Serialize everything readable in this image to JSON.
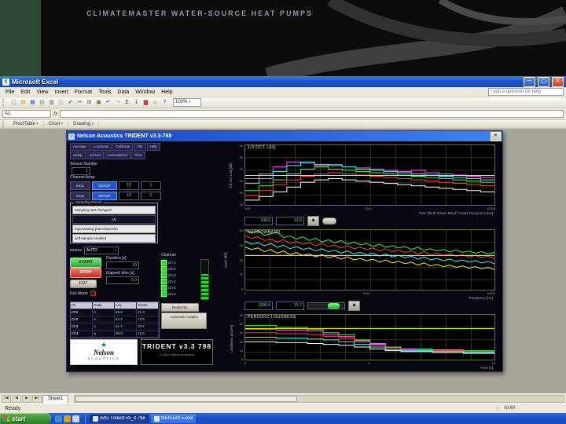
{
  "slide": {
    "title": "CLIMATEMASTER WATER-SOURCE HEAT PUMPS"
  },
  "excel": {
    "window_title": "Microsoft Excel",
    "menus": [
      "File",
      "Edit",
      "View",
      "Insert",
      "Format",
      "Tools",
      "Data",
      "Window",
      "Help"
    ],
    "help_placeholder": "Type a question for help",
    "name_box": "A1",
    "zoom_value": "100%",
    "toolbar_icons": [
      {
        "name": "new-icon",
        "glyph": "▢",
        "fg": "#4a6da8"
      },
      {
        "name": "open-icon",
        "glyph": "▤",
        "fg": "#c89020"
      },
      {
        "name": "save-icon",
        "glyph": "▦",
        "fg": "#3b5bbf"
      },
      {
        "name": "email-icon",
        "glyph": "▧",
        "fg": "#7a8ab0"
      },
      {
        "name": "print-icon",
        "glyph": "▥",
        "fg": "#666666"
      },
      {
        "name": "print-preview-icon",
        "glyph": "◫",
        "fg": "#888888"
      },
      {
        "name": "spelling-icon",
        "glyph": "✔",
        "fg": "#2f7d2f"
      },
      {
        "name": "cut-icon",
        "glyph": "✂",
        "fg": "#555555"
      },
      {
        "name": "copy-icon",
        "glyph": "⊞",
        "fg": "#556699"
      },
      {
        "name": "paste-icon",
        "glyph": "▣",
        "fg": "#8a6a3a"
      },
      {
        "name": "undo-icon",
        "glyph": "↶",
        "fg": "#2a5ad0"
      },
      {
        "name": "redo-icon",
        "glyph": "↷",
        "fg": "#98a2b8"
      },
      {
        "name": "autosum-icon",
        "glyph": "Σ",
        "fg": "#333333"
      },
      {
        "name": "sort-asc-icon",
        "glyph": "↧",
        "fg": "#446688"
      },
      {
        "name": "chart-wizard-icon",
        "glyph": "▆",
        "fg": "#c04040"
      },
      {
        "name": "drawing-icon",
        "glyph": "◇",
        "fg": "#4a8a4a"
      },
      {
        "name": "help-icon",
        "glyph": "?",
        "fg": "#2a5ad0"
      }
    ],
    "toolbar2_items": [
      "PivotTable",
      "Chart",
      "Drawing"
    ],
    "sheet_tab": "Sheet1",
    "status_left": "Ready",
    "status_num": "NUM"
  },
  "trident": {
    "title": "Nelson Acoustics TRIDENT v3.3-798",
    "tabs_row1": [
      "Average",
      "Loudness",
      "Calibrate",
      "File",
      "Help"
    ],
    "tabs_row2": [
      "Setup",
      "1/3 Oct",
      "Narrowband",
      "Time"
    ],
    "sensor_number_label": "Sensor Number",
    "sensor_number": "1",
    "channel_array_label": "Channel Array",
    "key_rows": [
      {
        "key": "Key1",
        "toggle": "On-ICP",
        "gain": "10",
        "ch": "1"
      },
      {
        "key": "Key2",
        "toggle": "On-ICP",
        "gain": "10",
        "ch": "2"
      }
    ],
    "sampling": {
      "group_label": "Sampling Period",
      "rows": [
        "sampling rate changed!",
        "AC",
        "input analog (low channels)",
        "self-sample enabled"
      ]
    },
    "source_label": "source",
    "source_value": "AUTO",
    "start": "START",
    "stop": "STOP",
    "exit": "EXIT",
    "key_alarm": "Key Alarm",
    "duration_label": "Duration [s]",
    "duration_value": "10",
    "elapsed_label": "Elapsed time [s]",
    "elapsed_value": "0.0",
    "channel_label": "Channel",
    "channels": [
      "Ch 1",
      "Ch 2",
      "Ch 3",
      "Ch 4",
      "Ch 5",
      "Ch 6"
    ],
    "reset_dl": "Reset D/L",
    "auto_graphs": "Automatic Graphs",
    "table": {
      "headers": [
        "Ch",
        "Code",
        "Leq",
        "Sones"
      ],
      "rows": [
        [
          "Ch1",
          "A",
          "68.4",
          "21.3"
        ],
        [
          "Ch2",
          "A",
          "64.2",
          "17.8"
        ],
        [
          "Ch3",
          "A",
          "61.7",
          "15.2"
        ],
        [
          "Ch4",
          "A",
          "58.9",
          "12.6"
        ]
      ]
    },
    "logo": {
      "brand": "Nelson",
      "brand2": "ACOUSTICS",
      "product": "TRIDENT v3.3 798",
      "copyright": "© 2004 Nelson Acoustics"
    },
    "controls1": {
      "v1": "100.0",
      "v2": "63.0"
    },
    "controls2": {
      "v1": "1000.0",
      "v2": "15.7"
    }
  },
  "taskbar": {
    "start_label": "start",
    "quick_launch": [
      {
        "name": "browser-icon",
        "color": "#3f8fd0"
      },
      {
        "name": "mail-icon",
        "color": "#d8a020"
      },
      {
        "name": "show-desktop-icon",
        "color": "#cfd8e8"
      }
    ],
    "tasks": [
      {
        "label": "IMG Trident v3_3 798",
        "active": true
      },
      {
        "label": "Microsoft Excel",
        "active": false
      }
    ]
  },
  "chart_data": [
    {
      "type": "step",
      "title": "1/3 OCT LEQ",
      "ylabel": "1/3 Oct Leq [dB]",
      "xlabel": "One-Third Octave Band Center Frequency [Hz]",
      "xticks": [
        "100",
        "1000",
        "10000"
      ],
      "yticks": [
        90,
        80,
        70,
        60,
        50,
        40
      ],
      "ylim": [
        40,
        90
      ],
      "cursor_frac": 0.5,
      "series": [
        {
          "name": "Ch 1",
          "color": "#ff55ff",
          "values": [
            62,
            66,
            72,
            76,
            75,
            73,
            74,
            72,
            71,
            70,
            69,
            68,
            69,
            67,
            66,
            65,
            64,
            63
          ]
        },
        {
          "name": "Ch 2",
          "color": "#44eeee",
          "values": [
            58,
            62,
            68,
            73,
            76,
            74,
            73,
            72,
            70,
            69,
            68,
            67,
            66,
            65,
            64,
            63,
            62,
            61
          ]
        },
        {
          "name": "Ch 3",
          "color": "#44ee44",
          "values": [
            52,
            56,
            61,
            66,
            70,
            72,
            70,
            69,
            68,
            67,
            66,
            65,
            64,
            63,
            62,
            61,
            60,
            59
          ]
        },
        {
          "name": "Ch 4",
          "color": "#ee4444",
          "values": [
            48,
            52,
            57,
            61,
            64,
            66,
            67,
            66,
            65,
            64,
            63,
            62,
            61,
            60,
            59,
            58,
            57,
            56
          ]
        },
        {
          "name": "Ch 5",
          "color": "#ffffff",
          "values": [
            44,
            47,
            51,
            55,
            59,
            61,
            62,
            61,
            60,
            59,
            58,
            57,
            56,
            55,
            54,
            53,
            52,
            51
          ]
        }
      ]
    },
    {
      "type": "line",
      "title": "NARROWBAND",
      "ylabel": "Level [dB]",
      "xlabel": "Frequency [Hz]",
      "xticks": [
        "0",
        "5000",
        "10000"
      ],
      "yticks": [
        80,
        60,
        40,
        20,
        0
      ],
      "ylim": [
        0,
        80
      ],
      "cursor_frac": 0.42,
      "series": [
        {
          "name": "Ch 1",
          "color": "#44ee44",
          "values": [
            80,
            76,
            79,
            73,
            75,
            77,
            70,
            72,
            68,
            71,
            66,
            69,
            64,
            67,
            63,
            66,
            61,
            64,
            60,
            62,
            58,
            61,
            57,
            59,
            56,
            58,
            54,
            57,
            53,
            55,
            52,
            54,
            51,
            53,
            50,
            52,
            49,
            51,
            48,
            50
          ]
        },
        {
          "name": "Ch 2",
          "color": "#ee4444",
          "values": [
            72,
            69,
            71,
            66,
            68,
            64,
            67,
            62,
            65,
            61,
            63,
            59,
            62,
            58,
            60,
            56,
            59,
            55,
            57,
            54,
            56,
            52,
            55,
            51,
            53,
            50,
            52,
            48,
            51,
            47,
            49,
            46,
            48,
            45,
            47,
            44,
            46,
            43,
            45,
            42
          ]
        },
        {
          "name": "Ch 3",
          "color": "#44eeee",
          "values": [
            65,
            61,
            63,
            59,
            62,
            57,
            60,
            55,
            58,
            54,
            56,
            52,
            55,
            51,
            53,
            49,
            52,
            48,
            50,
            47,
            49,
            45,
            48,
            44,
            46,
            43,
            45,
            41,
            44,
            40,
            42,
            39,
            41,
            38,
            40,
            37,
            39,
            36,
            38,
            35
          ]
        },
        {
          "name": "Ch 4",
          "color": "#eeee44",
          "values": [
            57,
            54,
            56,
            51,
            54,
            49,
            52,
            47,
            50,
            46,
            48,
            44,
            47,
            43,
            45,
            41,
            44,
            40,
            42,
            39,
            41,
            37,
            40,
            36,
            38,
            35,
            37,
            33,
            36,
            32,
            34,
            31,
            33,
            30,
            32,
            29,
            31,
            28,
            30,
            27
          ]
        }
      ]
    },
    {
      "type": "step",
      "title": "PERIODIC LOUDNESS",
      "ylabel": "Loudness [sones]",
      "xlabel": "Time [s]",
      "xticks": [
        "0",
        "5",
        "10"
      ],
      "yticks": [
        50,
        40,
        30,
        20,
        10,
        0
      ],
      "ylim": [
        0,
        50
      ],
      "cursor_frac": 0.3,
      "series": [
        {
          "name": "Ch 1",
          "color": "#44ee44",
          "values": [
            38,
            38,
            36,
            36,
            34,
            30,
            28,
            22,
            18,
            14,
            12,
            12,
            11,
            11,
            10,
            10
          ]
        },
        {
          "name": "Ch 2",
          "color": "#ff55ff",
          "values": [
            34,
            34,
            33,
            33,
            32,
            28,
            26,
            21,
            17,
            13,
            12,
            11,
            10,
            10,
            9,
            9
          ]
        },
        {
          "name": "Ch 3",
          "color": "#ee4444",
          "values": [
            30,
            30,
            29,
            29,
            28,
            26,
            24,
            20,
            16,
            13,
            11,
            11,
            10,
            10,
            9,
            9
          ]
        },
        {
          "name": "Ch 4",
          "color": "#44eeee",
          "values": [
            25,
            25,
            24,
            24,
            23,
            22,
            20,
            17,
            14,
            11,
            10,
            10,
            9,
            9,
            8,
            8
          ]
        },
        {
          "name": "Ch 5",
          "color": "#ffffff",
          "values": [
            20,
            20,
            19,
            19,
            18,
            17,
            16,
            14,
            12,
            10,
            9,
            9,
            8,
            8,
            7,
            7
          ]
        }
      ]
    }
  ]
}
